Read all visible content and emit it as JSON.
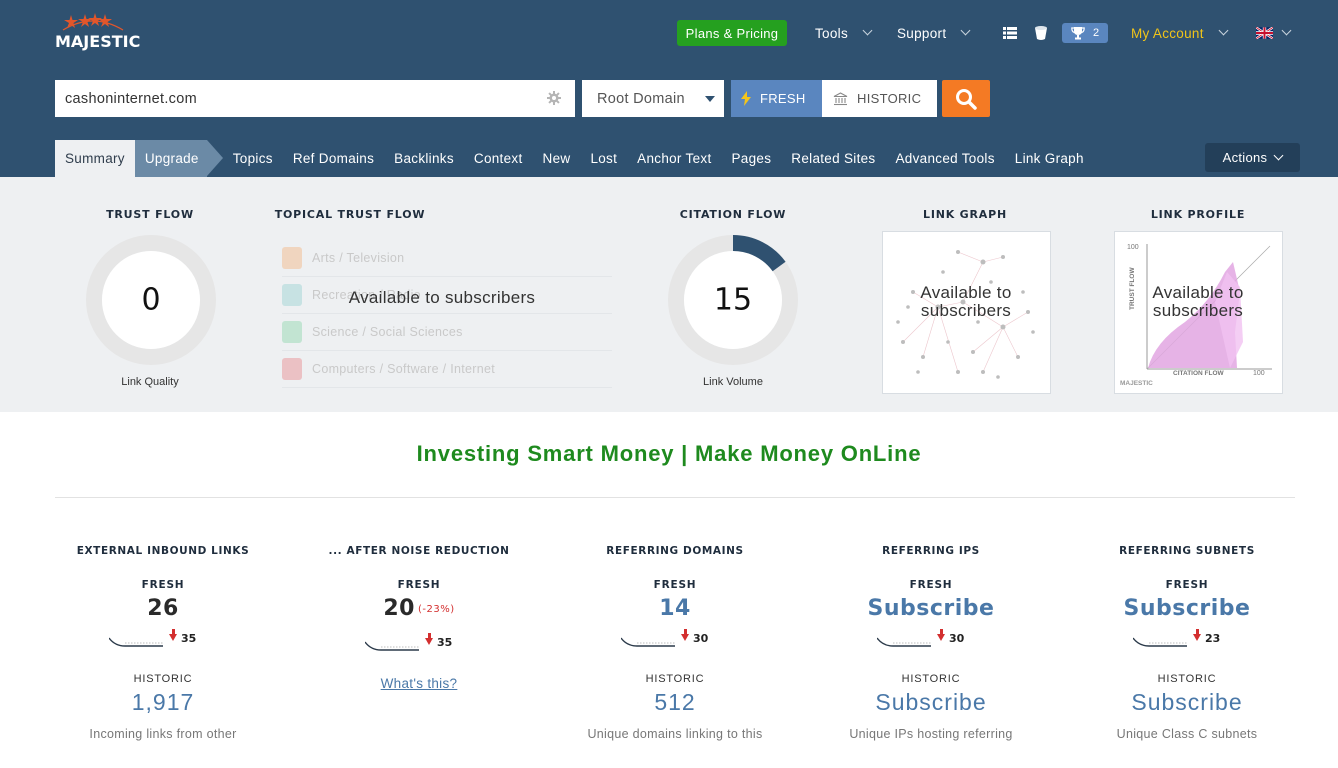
{
  "brand": {
    "name": "MAJESTIC"
  },
  "topnav": {
    "plans_label": "Plans & Pricing",
    "tools_label": "Tools",
    "support_label": "Support",
    "trophy_count": "2",
    "account_label": "My Account"
  },
  "search": {
    "value": "cashoninternet.com",
    "scope": "Root Domain",
    "fresh_label": "FRESH",
    "historic_label": "HISTORIC"
  },
  "tabs": [
    {
      "label": "Summary"
    },
    {
      "label": "Upgrade"
    },
    {
      "label": "Topics"
    },
    {
      "label": "Ref Domains"
    },
    {
      "label": "Backlinks"
    },
    {
      "label": "Context"
    },
    {
      "label": "New"
    },
    {
      "label": "Lost"
    },
    {
      "label": "Anchor Text"
    },
    {
      "label": "Pages"
    },
    {
      "label": "Related Sites"
    },
    {
      "label": "Advanced Tools"
    },
    {
      "label": "Link Graph"
    }
  ],
  "actions_label": "Actions",
  "metrics": {
    "trust_flow": {
      "title": "TRUST FLOW",
      "value": "0",
      "caption": "Link Quality",
      "fraction": 0.0
    },
    "topical": {
      "title": "TOPICAL TRUST FLOW",
      "overlay": "Available to subscribers",
      "topics": [
        {
          "label": "Arts / Television",
          "color": "#f4a261"
        },
        {
          "label": "Recreation / Radio",
          "color": "#7ec8c8"
        },
        {
          "label": "Science / Social Sciences",
          "color": "#6fcf97"
        },
        {
          "label": "Computers / Software / Internet",
          "color": "#e56b6f"
        }
      ]
    },
    "citation_flow": {
      "title": "CITATION FLOW",
      "value": "15",
      "caption": "Link Volume",
      "fraction": 0.15
    },
    "link_graph": {
      "title": "LINK GRAPH",
      "overlay_line1": "Available to",
      "overlay_line2": "subscribers"
    },
    "link_profile": {
      "title": "LINK PROFILE",
      "overlay_line1": "Available to",
      "overlay_line2": "subscribers",
      "axis_y": "TRUST FLOW",
      "axis_x": "CITATION FLOW",
      "tick_max": "100",
      "watermark": "MAJESTIC"
    },
    "colors": {
      "donut_track": "#e6e6e6",
      "donut_fill": "#2f5170"
    }
  },
  "site_title": "Investing Smart Money | Make Money OnLine",
  "stats": [
    {
      "title": "EXTERNAL INBOUND LINKS",
      "fresh_label": "FRESH",
      "fresh_value": "26",
      "fresh_pct": "",
      "prev": "35",
      "historic_label": "HISTORIC",
      "historic_value": "1,917",
      "link": "",
      "desc": "Incoming links from other"
    },
    {
      "title": "... AFTER NOISE REDUCTION",
      "fresh_label": "FRESH",
      "fresh_value": "20",
      "fresh_pct": "(-23%)",
      "prev": "35",
      "historic_label": "",
      "historic_value": "",
      "link": "What's this?",
      "desc": ""
    },
    {
      "title": "REFERRING DOMAINS",
      "fresh_label": "FRESH",
      "fresh_value": "14",
      "fresh_pct": "",
      "prev": "30",
      "historic_label": "HISTORIC",
      "historic_value": "512",
      "link": "",
      "desc": "Unique domains linking to this"
    },
    {
      "title": "REFERRING IPS",
      "fresh_label": "FRESH",
      "fresh_value": "Subscribe",
      "fresh_pct": "",
      "prev": "30",
      "historic_label": "HISTORIC",
      "historic_value": "Subscribe",
      "link": "",
      "desc": "Unique IPs hosting referring"
    },
    {
      "title": "REFERRING SUBNETS",
      "fresh_label": "FRESH",
      "fresh_value": "Subscribe",
      "fresh_pct": "",
      "prev": "23",
      "historic_label": "HISTORIC",
      "historic_value": "Subscribe",
      "link": "",
      "desc": "Unique Class C subnets"
    }
  ]
}
